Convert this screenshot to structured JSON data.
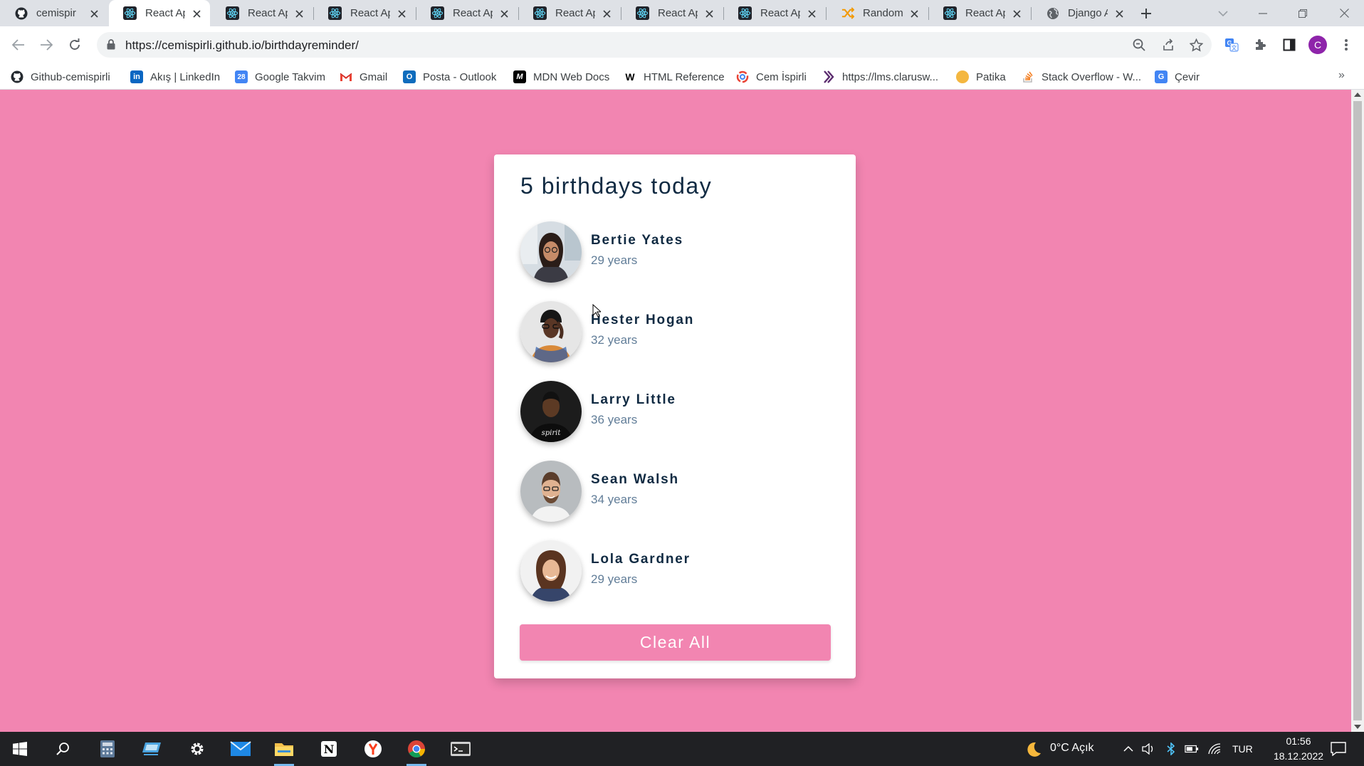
{
  "browser": {
    "tabs": [
      {
        "title": "cemispirli",
        "icon": "github-icon"
      },
      {
        "title": "React App",
        "icon": "react-icon",
        "active": true
      },
      {
        "title": "React App",
        "icon": "react-icon"
      },
      {
        "title": "React App",
        "icon": "react-icon"
      },
      {
        "title": "React App",
        "icon": "react-icon"
      },
      {
        "title": "React App",
        "icon": "react-icon"
      },
      {
        "title": "React App",
        "icon": "react-icon"
      },
      {
        "title": "React App",
        "icon": "react-icon"
      },
      {
        "title": "Random",
        "icon": "shuffle-icon"
      },
      {
        "title": "React App",
        "icon": "react-icon"
      },
      {
        "title": "Django A",
        "icon": "globe-icon"
      }
    ],
    "url": "https://cemispirli.github.io/birthdayreminder/",
    "profile_initial": "C",
    "bookmarks": [
      {
        "label": "Github-cemispirli",
        "icon": "github-icon"
      },
      {
        "label": "Akış | LinkedIn",
        "icon": "linkedin-icon"
      },
      {
        "label": "Google Takvim",
        "icon": "calendar-icon"
      },
      {
        "label": "Gmail",
        "icon": "gmail-icon"
      },
      {
        "label": "Posta - Outlook",
        "icon": "outlook-icon"
      },
      {
        "label": "MDN Web Docs",
        "icon": "mdn-icon"
      },
      {
        "label": "HTML Reference",
        "icon": "w3-icon"
      },
      {
        "label": "Cem İspirli",
        "icon": "swirl-icon"
      },
      {
        "label": "https://lms.clarusw...",
        "icon": "clarusway-icon"
      },
      {
        "label": "Patika",
        "icon": "patika-icon"
      },
      {
        "label": "Stack Overflow - W...",
        "icon": "stackoverflow-icon"
      },
      {
        "label": "Çevir",
        "icon": "translate-icon"
      }
    ],
    "bookmarks_more": "»"
  },
  "app": {
    "heading": "5 birthdays today",
    "people": [
      {
        "name": "Bertie Yates",
        "age": "29 years"
      },
      {
        "name": "Hester Hogan",
        "age": "32 years"
      },
      {
        "name": "Larry Little",
        "age": "36 years"
      },
      {
        "name": "Sean Walsh",
        "age": "34 years"
      },
      {
        "name": "Lola Gardner",
        "age": "29 years"
      }
    ],
    "clear_label": "Clear All",
    "colors": {
      "background": "#f285b1",
      "heading": "#102a42",
      "age": "#617d98",
      "button": "#f285b1"
    }
  },
  "taskbar": {
    "apps": [
      "windows-start-icon",
      "search-icon",
      "calculator-icon",
      "remote-desktop-icon",
      "settings-icon",
      "mail-icon",
      "file-explorer-icon",
      "notion-icon",
      "yandex-icon",
      "chrome-icon",
      "terminal-icon"
    ],
    "weather": "0°C Açık",
    "language": "TUR",
    "time": "01:56",
    "date": "18.12.2022"
  }
}
